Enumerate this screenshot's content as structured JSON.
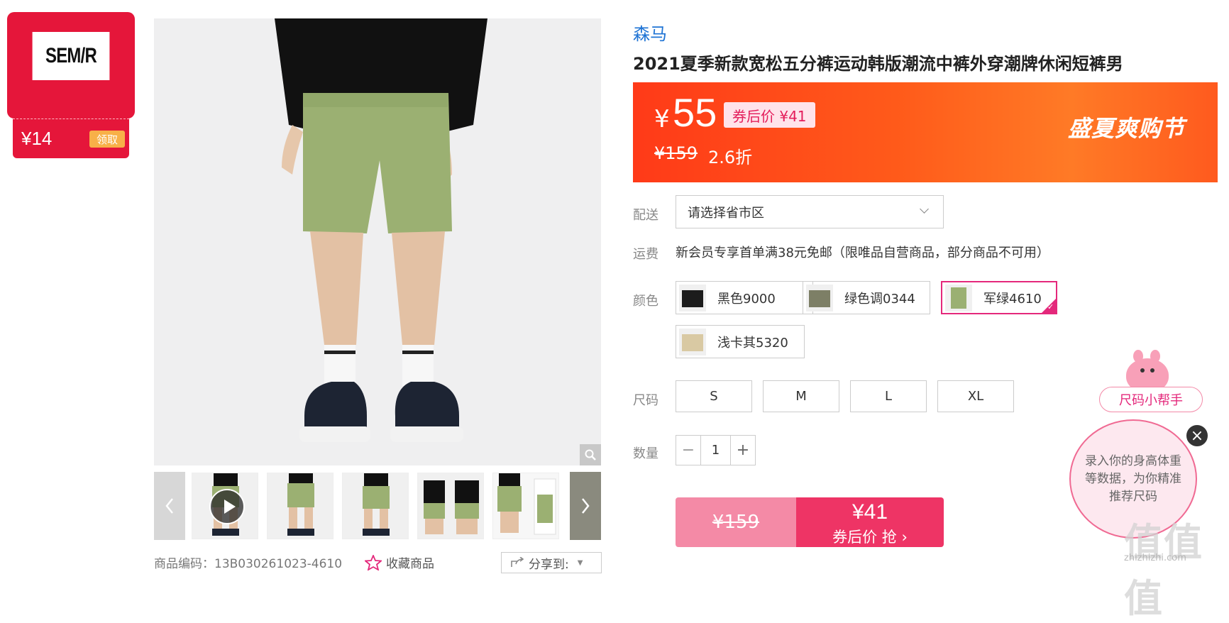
{
  "coupon": {
    "brand_logo": "SEM/R",
    "amount": "¥14",
    "claim_label": "领取"
  },
  "gallery": {
    "thumbnails": [
      {
        "name": "thumb-1",
        "has_video": true
      },
      {
        "name": "thumb-2"
      },
      {
        "name": "thumb-3"
      },
      {
        "name": "thumb-4"
      },
      {
        "name": "thumb-5"
      },
      {
        "name": "thumb-6"
      }
    ]
  },
  "meta": {
    "sku_label": "商品编码：13B030261023-4610",
    "favorite_label": "收藏商品",
    "share_label": "分享到:"
  },
  "product": {
    "brand": "森马",
    "title": "2021夏季新款宽松五分裤运动韩版潮流中裤外穿潮牌休闲短裤男"
  },
  "price": {
    "currency": "¥",
    "current": "55",
    "after_coupon": "券后价 ¥41",
    "original": "¥159",
    "discount": "2.6折",
    "festival": "盛夏爽购节"
  },
  "delivery": {
    "label": "配送",
    "placeholder": "请选择省市区"
  },
  "shipping": {
    "label": "运费",
    "text": "新会员专享首单满38元免邮（限唯品自营商品，部分商品不可用）"
  },
  "color": {
    "label": "颜色",
    "options": [
      {
        "label": "黑色9000",
        "swatch": "#1c1c1c"
      },
      {
        "label": "绿色调0344",
        "swatch": "#7d7f66"
      },
      {
        "label": "军绿4610",
        "swatch": "#9bb072",
        "selected": true
      },
      {
        "label": "浅卡其5320",
        "swatch": "#d9c9a3"
      }
    ]
  },
  "size": {
    "label": "尺码",
    "options": [
      "S",
      "M",
      "L",
      "XL"
    ]
  },
  "quantity": {
    "label": "数量",
    "value": "1",
    "minus": "−",
    "plus": "+"
  },
  "buy": {
    "original": "¥159",
    "price": "¥41",
    "cta": "券后价 抢 ›"
  },
  "size_helper": {
    "title": "尺码小帮手",
    "message": "录入你的身高体重等数据，为你精准推荐尺码",
    "close": "×"
  },
  "watermark": {
    "text": "值值值",
    "url": "zhizhizhi.com"
  },
  "colors": {
    "accent": "#e4287b",
    "banner": "#ff4a1a",
    "link": "#1e73d4",
    "coupon": "#e5163a"
  }
}
